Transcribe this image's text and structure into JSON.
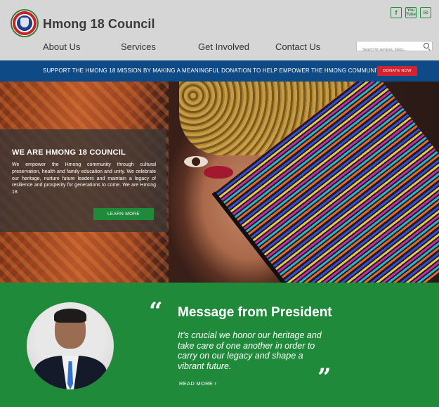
{
  "header": {
    "brand": "Hmong 18 Council",
    "nav": [
      "About Us",
      "Services",
      "Get Involved",
      "Contact Us"
    ],
    "search_placeholder": "Search for services, topics...",
    "social": {
      "facebook": "f",
      "youtube": "You Tube",
      "email": "✉"
    }
  },
  "banner": {
    "text": "SUPPORT THE HMONG 18 MISSION BY MAKING A MEANINGFUL DONATION TO HELP EMPOWER THE HMONG COMMUNITY",
    "donate_label": "DONATE NOW"
  },
  "hero": {
    "title": "WE ARE HMONG 18 COUNCIL",
    "body": "We empower the Hmong community through cultural preservation, health and family education and unity. We celebrate our heritage, nurture future leaders and maintain a legacy of resilience and prosperity for generations to come. We are Hmong 18.",
    "button_label": "LEARN MORE"
  },
  "president": {
    "open_quote": "“",
    "close_quote": "”",
    "title": "Message from President",
    "quote": "It’s crucial we honor our heritage and take care of one another in order to carry on our legacy and shape a vibrant future.",
    "read_more": "READ MORE",
    "chevron": "›"
  },
  "colors": {
    "header_bg": "#d6d6d6",
    "banner_bg": "#0d4a86",
    "donate_red": "#d32331",
    "brand_green": "#1f8a3a"
  }
}
